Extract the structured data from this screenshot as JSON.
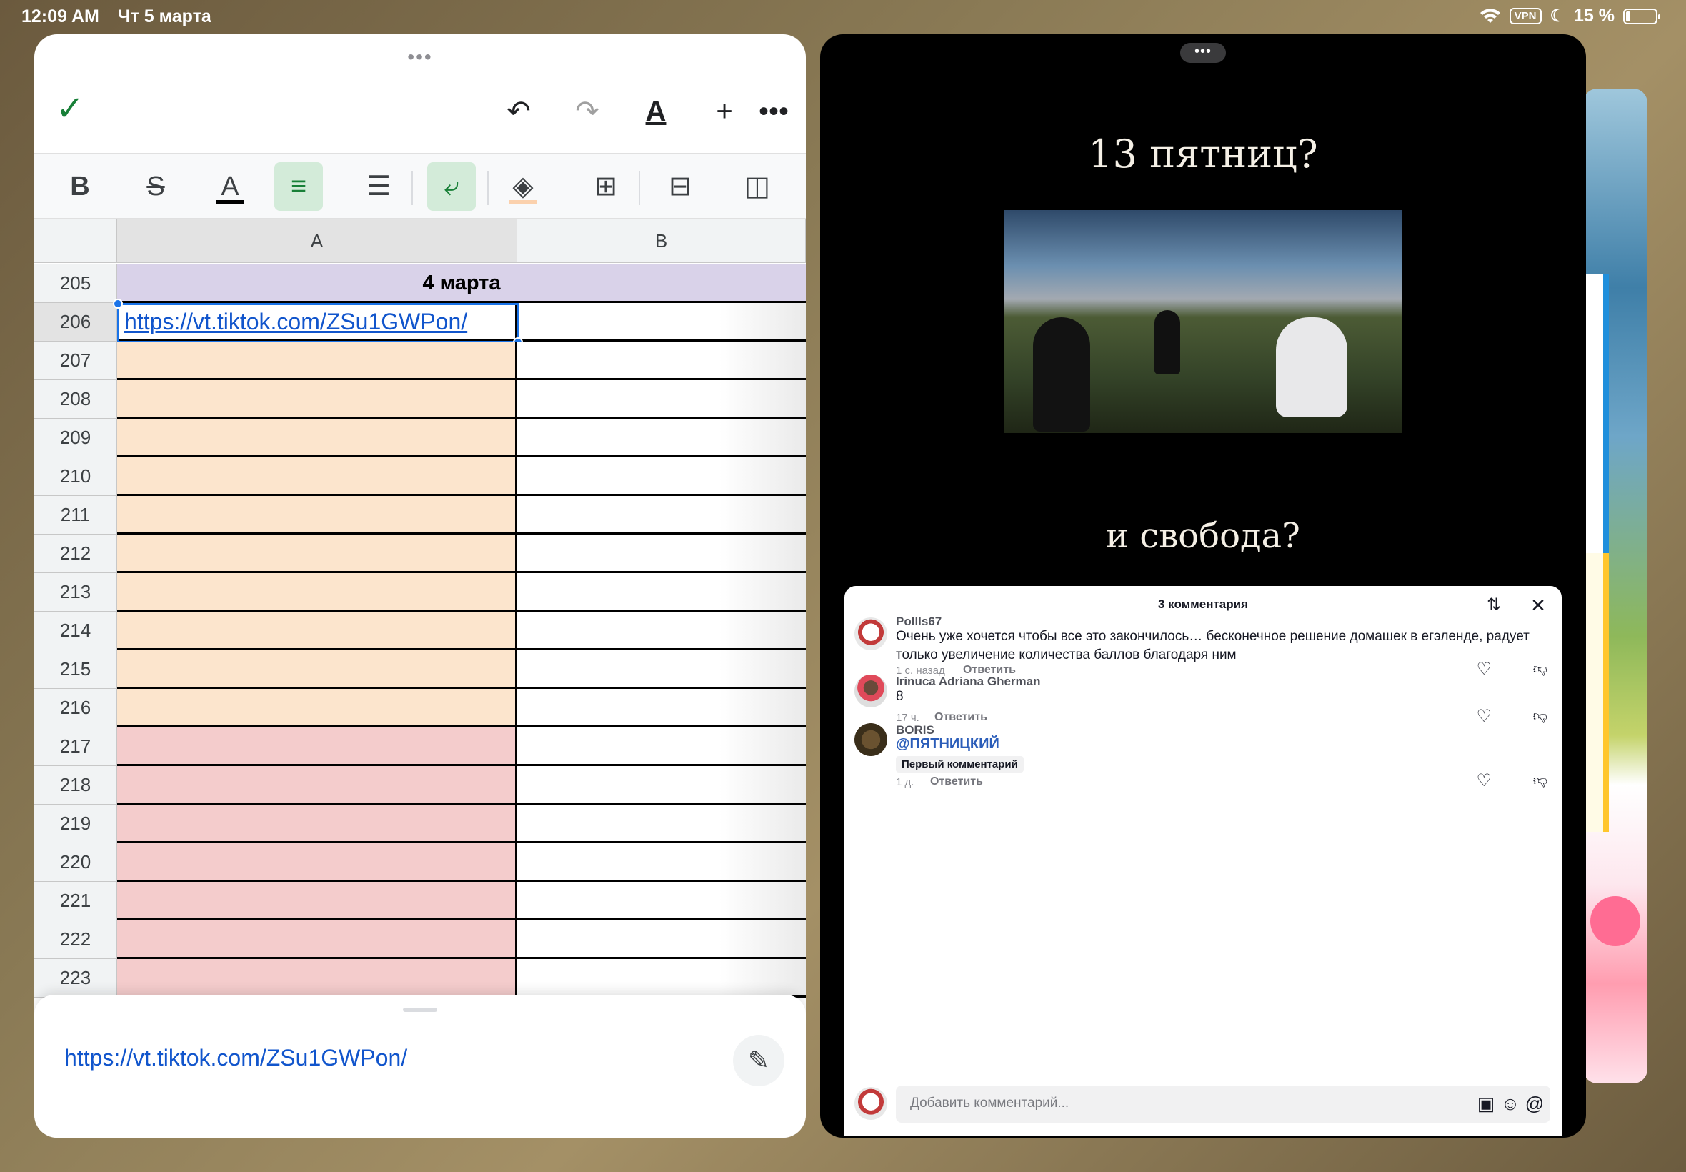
{
  "status_bar": {
    "time": "12:09 AM",
    "date": "Чт 5 марта",
    "vpn": "VPN",
    "battery": "15 %",
    "battery_level": 0.15,
    "icons": [
      "wifi-icon",
      "moon-icon",
      "battery-icon"
    ]
  },
  "sheets": {
    "toolbar": {
      "icons": [
        "check-icon",
        "undo-icon",
        "redo-icon",
        "text-format-icon",
        "insert-icon",
        "more-icon"
      ]
    },
    "format_bar": {
      "bold": "B",
      "strike": "S",
      "text_color": "A",
      "icons": [
        "align-left-icon",
        "align-center-icon",
        "wrap-icon",
        "fill-color-icon",
        "borders-icon",
        "insert-row-icon",
        "insert-column-icon"
      ]
    },
    "columns": [
      "A",
      "B"
    ],
    "rows": [
      {
        "num": "205",
        "a": "4 марта",
        "style": "merged"
      },
      {
        "num": "206",
        "a": "https://vt.tiktok.com/ZSu1GWPon/",
        "style": "link"
      },
      {
        "num": "207",
        "a": "",
        "style": "peach"
      },
      {
        "num": "208",
        "a": "",
        "style": "peach"
      },
      {
        "num": "209",
        "a": "",
        "style": "peach"
      },
      {
        "num": "210",
        "a": "",
        "style": "peach"
      },
      {
        "num": "211",
        "a": "",
        "style": "peach"
      },
      {
        "num": "212",
        "a": "",
        "style": "peach"
      },
      {
        "num": "213",
        "a": "",
        "style": "peach"
      },
      {
        "num": "214",
        "a": "",
        "style": "peach"
      },
      {
        "num": "215",
        "a": "",
        "style": "peach"
      },
      {
        "num": "216",
        "a": "",
        "style": "peach"
      },
      {
        "num": "217",
        "a": "",
        "style": "pink"
      },
      {
        "num": "218",
        "a": "",
        "style": "pink"
      },
      {
        "num": "219",
        "a": "",
        "style": "pink"
      },
      {
        "num": "220",
        "a": "",
        "style": "pink"
      },
      {
        "num": "221",
        "a": "",
        "style": "pink"
      },
      {
        "num": "222",
        "a": "",
        "style": "pink"
      },
      {
        "num": "223",
        "a": "",
        "style": "pink"
      }
    ],
    "detail_url": "https://vt.tiktok.com/ZSu1GWPon/",
    "colors": {
      "peach": "#fce5cd",
      "pink": "#f4cccc",
      "header_merged": "#d9d2e9",
      "accent": "#188038",
      "link": "#1155cc"
    }
  },
  "video": {
    "line1": "13 пятниц?",
    "line2": "и свобода?"
  },
  "comments": {
    "title": "3 комментария",
    "items": [
      {
        "user": "Pollls67",
        "text": "Очень уже хочется чтобы все это закончилось… бесконечное решение домашек в егэленде, радует только увеличение количества баллов благодаря ним",
        "time": "1 с. назад",
        "reply": "Ответить"
      },
      {
        "user": "Irinuca Adriana Gherman",
        "text": "8",
        "time": "17 ч.",
        "reply": "Ответить"
      },
      {
        "user": "BORIS",
        "mention": "@ПЯТНИЦКИЙ",
        "badge": "Первый комментарий",
        "time": "1 д.",
        "reply": "Ответить"
      }
    ],
    "input_placeholder": "Добавить комментарий..."
  }
}
